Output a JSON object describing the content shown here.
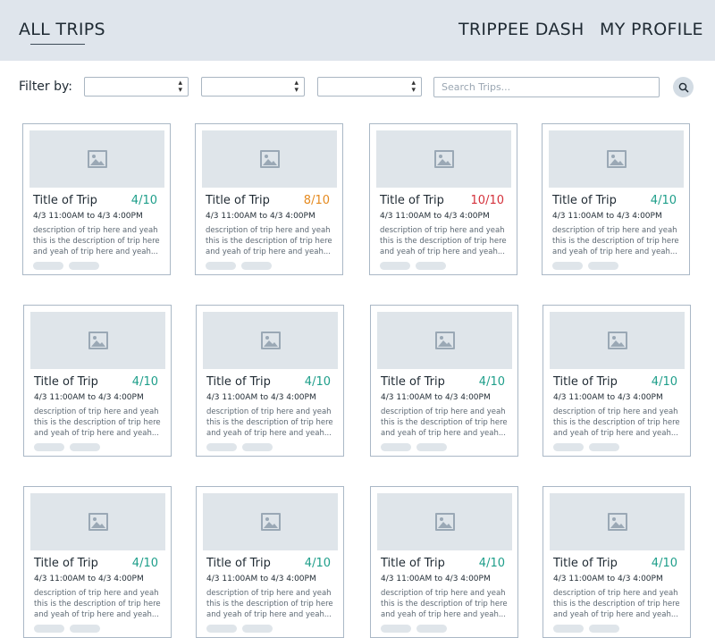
{
  "nav": {
    "all_trips": "ALL TRIPS",
    "dash": "TRIPPEE DASH",
    "profile": "MY PROFILE"
  },
  "filters": {
    "label": "Filter by:",
    "search_placeholder": "Search Trips..."
  },
  "colors": {
    "available": "#1e9e8a",
    "nearly_full": "#e58a1f",
    "full": "#d4313b"
  },
  "trips": [
    {
      "title": "Title of Trip",
      "count": "4/10",
      "status": "available",
      "time": "4/3 11:00AM to 4/3 4:00PM",
      "desc": "description of trip here and yeah this is the description of trip here and yeah of trip here and yeah..."
    },
    {
      "title": "Title of Trip",
      "count": "8/10",
      "status": "nearly_full",
      "time": "4/3 11:00AM to 4/3 4:00PM",
      "desc": "description of trip here and yeah this is the description of trip here and yeah of trip here and yeah..."
    },
    {
      "title": "Title of Trip",
      "count": "10/10",
      "status": "full",
      "time": "4/3 11:00AM to 4/3 4:00PM",
      "desc": "description of trip here and yeah this is the description of trip here and yeah of trip here and yeah..."
    },
    {
      "title": "Title of Trip",
      "count": "4/10",
      "status": "available",
      "time": "4/3 11:00AM to 4/3 4:00PM",
      "desc": "description of trip here and yeah this is the description of trip here and yeah of trip here and yeah..."
    },
    {
      "title": "Title of Trip",
      "count": "4/10",
      "status": "available",
      "time": "4/3 11:00AM to 4/3 4:00PM",
      "desc": "description of trip here and yeah this is the description of trip here and yeah of trip here and yeah..."
    },
    {
      "title": "Title of Trip",
      "count": "4/10",
      "status": "available",
      "time": "4/3 11:00AM to 4/3 4:00PM",
      "desc": "description of trip here and yeah this is the description of trip here and yeah of trip here and yeah..."
    },
    {
      "title": "Title of Trip",
      "count": "4/10",
      "status": "available",
      "time": "4/3 11:00AM to 4/3 4:00PM",
      "desc": "description of trip here and yeah this is the description of trip here and yeah of trip here and yeah..."
    },
    {
      "title": "Title of Trip",
      "count": "4/10",
      "status": "available",
      "time": "4/3 11:00AM to 4/3 4:00PM",
      "desc": "description of trip here and yeah this is the description of trip here and yeah of trip here and yeah..."
    },
    {
      "title": "Title of Trip",
      "count": "4/10",
      "status": "available",
      "time": "4/3 11:00AM to 4/3 4:00PM",
      "desc": "description of trip here and yeah this is the description of trip here and yeah of trip here and yeah..."
    },
    {
      "title": "Title of Trip",
      "count": "4/10",
      "status": "available",
      "time": "4/3 11:00AM to 4/3 4:00PM",
      "desc": "description of trip here and yeah this is the description of trip here and yeah of trip here and yeah..."
    },
    {
      "title": "Title of Trip",
      "count": "4/10",
      "status": "available",
      "time": "4/3 11:00AM to 4/3 4:00PM",
      "desc": "description of trip here and yeah this is the description of trip here and yeah of trip here and yeah..."
    },
    {
      "title": "Title of Trip",
      "count": "4/10",
      "status": "available",
      "time": "4/3 11:00AM to 4/3 4:00PM",
      "desc": "description of trip here and yeah this is the description of trip here and yeah of trip here and yeah..."
    }
  ]
}
